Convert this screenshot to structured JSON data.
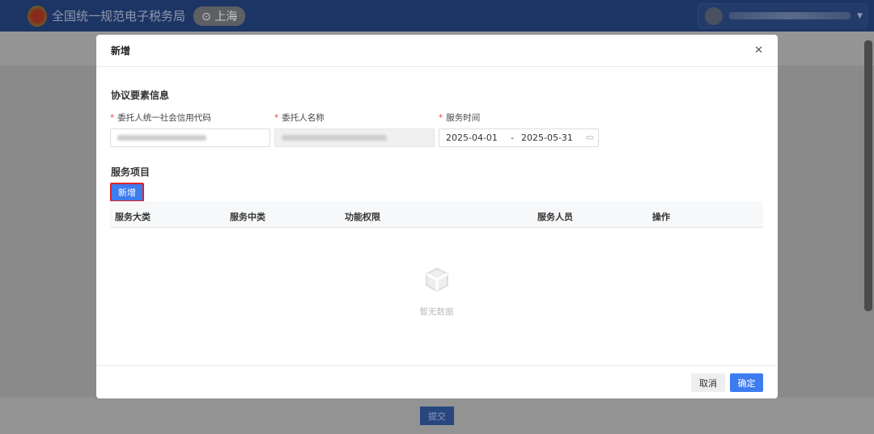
{
  "header": {
    "site_title": "全国统一规范电子税务局",
    "region": "上海",
    "location_icon": "location-pin-icon"
  },
  "footer": {
    "submit_label": "提交"
  },
  "modal": {
    "title": "新增",
    "section1": "协议要素信息",
    "fields": {
      "credit_code_label": "委托人统一社会信用代码",
      "name_label": "委托人名称",
      "service_time_label": "服务时间",
      "start_date": "2025-04-01",
      "separator": "-",
      "end_date": "2025-05-31"
    },
    "section2": "服务项目",
    "add_label": "新增",
    "columns": [
      "服务大类",
      "服务中类",
      "功能权限",
      "服务人员",
      "操作"
    ],
    "empty_text": "暂无数据",
    "cancel_label": "取消",
    "ok_label": "确定"
  }
}
